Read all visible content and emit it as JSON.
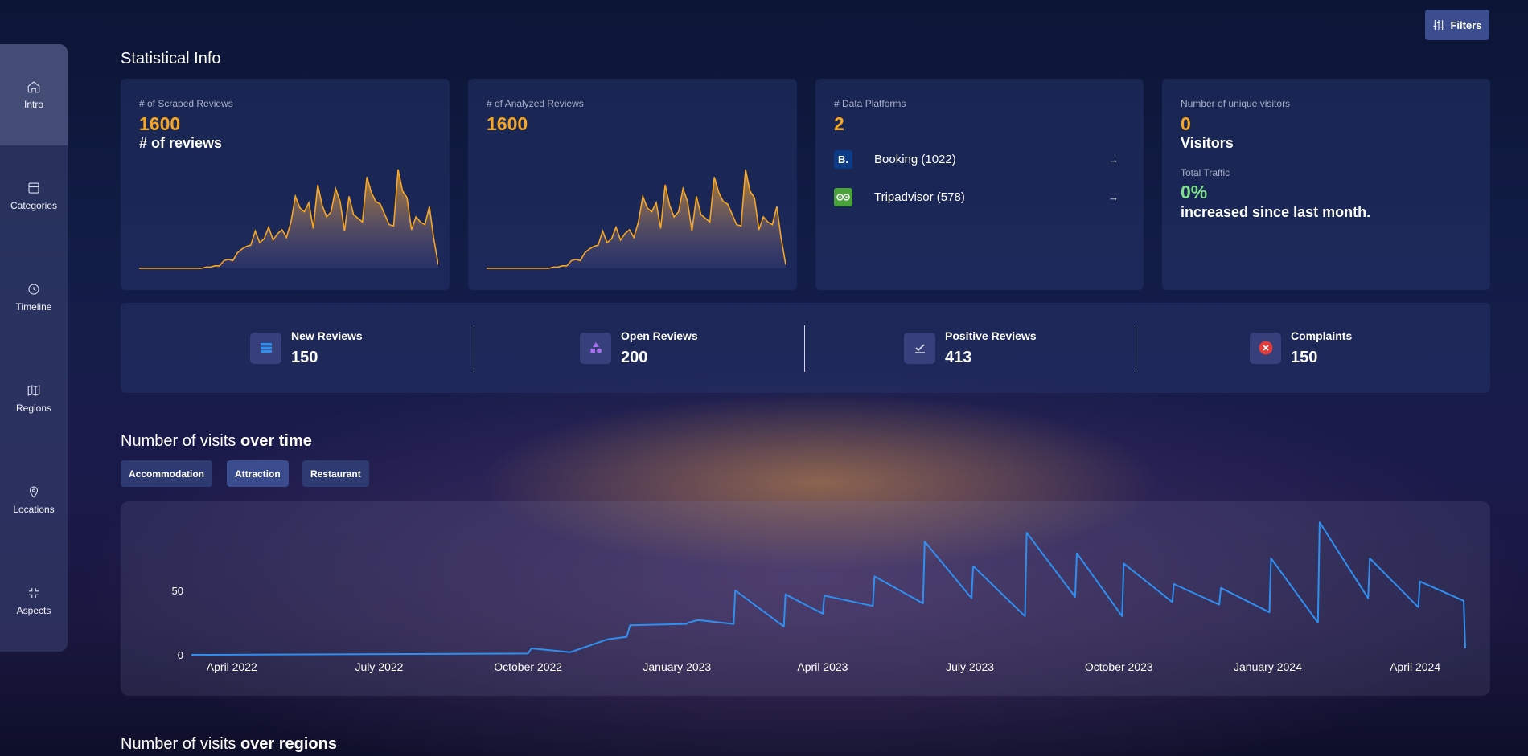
{
  "nav": {
    "items": [
      {
        "label": "Intro",
        "icon": "home-icon"
      },
      {
        "label": "Categories",
        "icon": "layout-icon"
      },
      {
        "label": "Timeline",
        "icon": "clock-icon"
      },
      {
        "label": "Regions",
        "icon": "map-icon"
      },
      {
        "label": "Locations",
        "icon": "map-pin-icon"
      },
      {
        "label": "Aspects",
        "icon": "shrink-icon"
      }
    ]
  },
  "header": {
    "filters_label": "Filters"
  },
  "statistical": {
    "title": "Statistical Info",
    "scraped": {
      "label": "# of Scraped Reviews",
      "value": "1600",
      "sub": "# of reviews"
    },
    "analyzed": {
      "label": "# of Analyzed Reviews",
      "value": "1600"
    },
    "platforms": {
      "label": "# Data Platforms",
      "value": "2",
      "items": [
        {
          "name": "Booking (1022)",
          "logo": "B.",
          "color": "#0b3a86"
        },
        {
          "name": "Tripadvisor (578)",
          "logo": "oo",
          "color": "#4aa33a"
        }
      ]
    },
    "visitors": {
      "label": "Number of unique visitors",
      "value": "0",
      "sub": "Visitors",
      "traffic_label": "Total Traffic",
      "traffic_value": "0%",
      "traffic_sub": "increased since last month."
    }
  },
  "stats": [
    {
      "label": "New Reviews",
      "value": "150",
      "icon": "inbox-icon"
    },
    {
      "label": "Open Reviews",
      "value": "200",
      "icon": "shapes-icon"
    },
    {
      "label": "Positive Reviews",
      "value": "413",
      "icon": "check-icon"
    },
    {
      "label": "Complaints",
      "value": "150",
      "icon": "x-circle-icon"
    }
  ],
  "visits_time": {
    "title_plain": "Number of visits ",
    "title_bold": "over time",
    "chips": [
      "Accommodation",
      "Attraction",
      "Restaurant"
    ],
    "active_chip": "Attraction"
  },
  "visits_regions": {
    "title_plain": "Number of visits ",
    "title_bold": "over regions"
  },
  "colors": {
    "accent": "#f5a623",
    "line": "#2f8ff0",
    "green": "#7ee08a"
  },
  "chart_data": [
    {
      "type": "area",
      "series": [
        {
          "values": [
            0,
            0,
            0,
            0,
            0,
            0,
            0,
            0,
            0,
            0,
            0,
            0,
            0,
            0,
            0,
            1,
            1,
            2,
            2,
            6,
            7,
            6,
            12,
            15,
            17,
            18,
            29,
            20,
            23,
            32,
            22,
            27,
            30,
            24,
            36,
            56,
            47,
            44,
            51,
            31,
            65,
            49,
            40,
            44,
            62,
            52,
            29,
            56,
            42,
            39,
            36,
            71,
            59,
            52,
            50,
            42,
            34,
            33,
            77,
            60,
            55,
            30,
            40,
            36,
            34,
            48,
            23,
            3
          ]
        }
      ],
      "ylim": [
        0,
        80
      ]
    },
    {
      "type": "area",
      "series": [
        {
          "values": [
            0,
            0,
            0,
            0,
            0,
            0,
            0,
            0,
            0,
            0,
            0,
            0,
            0,
            0,
            0,
            1,
            1,
            2,
            2,
            6,
            7,
            6,
            12,
            15,
            17,
            18,
            29,
            20,
            23,
            32,
            22,
            27,
            30,
            24,
            36,
            56,
            47,
            44,
            51,
            31,
            65,
            49,
            40,
            44,
            62,
            52,
            29,
            56,
            42,
            39,
            36,
            71,
            59,
            52,
            50,
            42,
            34,
            33,
            77,
            60,
            55,
            30,
            40,
            36,
            34,
            48,
            23,
            3
          ]
        }
      ],
      "ylim": [
        0,
        80
      ]
    },
    {
      "type": "line",
      "x": [
        "2022-03-07",
        "2022-10-01",
        "2022-10-03",
        "2022-10-27",
        "2022-11-19",
        "2022-12-01",
        "2022-12-03",
        "2023-01-07",
        "2023-01-08",
        "2023-01-14",
        "2023-02-05",
        "2023-02-06",
        "2023-03-08",
        "2023-03-09",
        "2023-04-01",
        "2023-04-02",
        "2023-05-02",
        "2023-05-03",
        "2023-06-02",
        "2023-06-03",
        "2023-07-02",
        "2023-07-03",
        "2023-08-04",
        "2023-08-05",
        "2023-09-04",
        "2023-09-05",
        "2023-10-03",
        "2023-10-04",
        "2023-11-03",
        "2023-11-04",
        "2023-12-02",
        "2023-12-03",
        "2024-01-02",
        "2024-01-03",
        "2024-02-01",
        "2024-02-02",
        "2024-03-03",
        "2024-03-04",
        "2024-04-03",
        "2024-04-04",
        "2024-05-01",
        "2024-05-02"
      ],
      "series": [
        {
          "name": "Visits",
          "values": [
            0,
            1,
            5,
            2,
            12,
            14,
            23,
            24,
            25,
            27,
            24,
            50,
            22,
            47,
            32,
            46,
            38,
            61,
            40,
            88,
            44,
            69,
            30,
            95,
            45,
            79,
            30,
            71,
            41,
            55,
            39,
            52,
            33,
            75,
            25,
            103,
            44,
            75,
            37,
            57,
            42,
            5
          ]
        }
      ],
      "yticks": [
        0,
        50
      ],
      "xticks": [
        "April 2022",
        "July 2022",
        "October 2022",
        "January 2023",
        "April 2023",
        "July 2023",
        "October 2023",
        "January 2024",
        "April 2024"
      ],
      "ylim": [
        0,
        110
      ]
    }
  ]
}
